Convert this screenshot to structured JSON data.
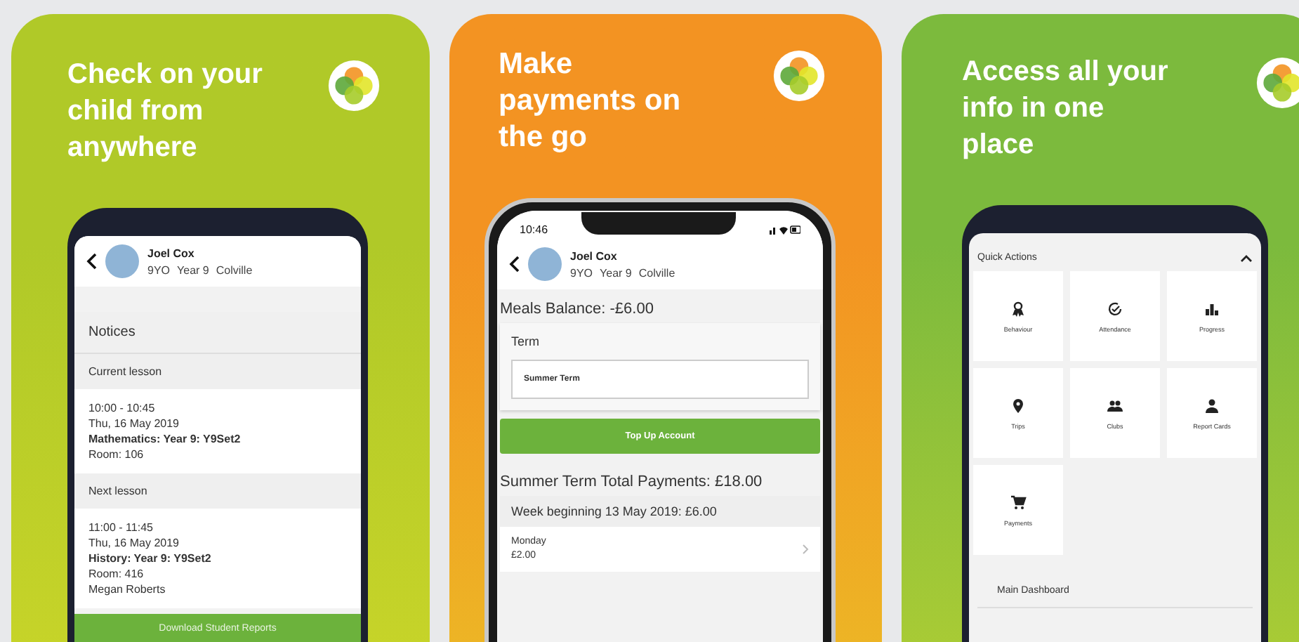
{
  "panels": [
    {
      "kind": "notices",
      "color": "#b0c928",
      "headline": "Check on your child from anywhere",
      "student": {
        "name": "Joel Cox",
        "meta": [
          "9YO",
          "Year 9",
          "Colville"
        ]
      },
      "section_title": "Notices",
      "lessons": [
        {
          "heading": "Current lesson",
          "time": "10:00 - 10:45",
          "date": "Thu, 16 May 2019",
          "subject": "Mathematics: Year 9: Y9Set2",
          "room": "Room: 106"
        },
        {
          "heading": "Next lesson",
          "time": "11:00 - 11:45",
          "date": "Thu, 16 May 2019",
          "subject": "History: Year 9: Y9Set2",
          "room": "Room: 416",
          "teacher": "Megan Roberts"
        }
      ],
      "button": "Download Student Reports"
    },
    {
      "kind": "payments",
      "color": "#f39322",
      "headline": "Make payments on the go",
      "status_time": "10:46",
      "student": {
        "name": "Joel Cox",
        "meta": [
          "9YO",
          "Year 9",
          "Colville"
        ]
      },
      "balance": "Meals Balance: -£6.00",
      "term_label": "Term",
      "term_value": "Summer Term",
      "button": "Top Up Account",
      "total": "Summer Term Total Payments: £18.00",
      "week": "Week beginning 13 May 2019: £6.00",
      "days": [
        {
          "day": "Monday",
          "amount": "£2.00"
        }
      ]
    },
    {
      "kind": "dashboard",
      "color": "#7cba3d",
      "headline": "Access all your info in one place",
      "section_title": "Quick Actions",
      "expanded": true,
      "tiles": [
        "Behaviour",
        "Attendance",
        "Progress",
        "Trips",
        "Clubs",
        "Report Cards",
        "Payments"
      ],
      "footer": "Main Dashboard"
    }
  ]
}
